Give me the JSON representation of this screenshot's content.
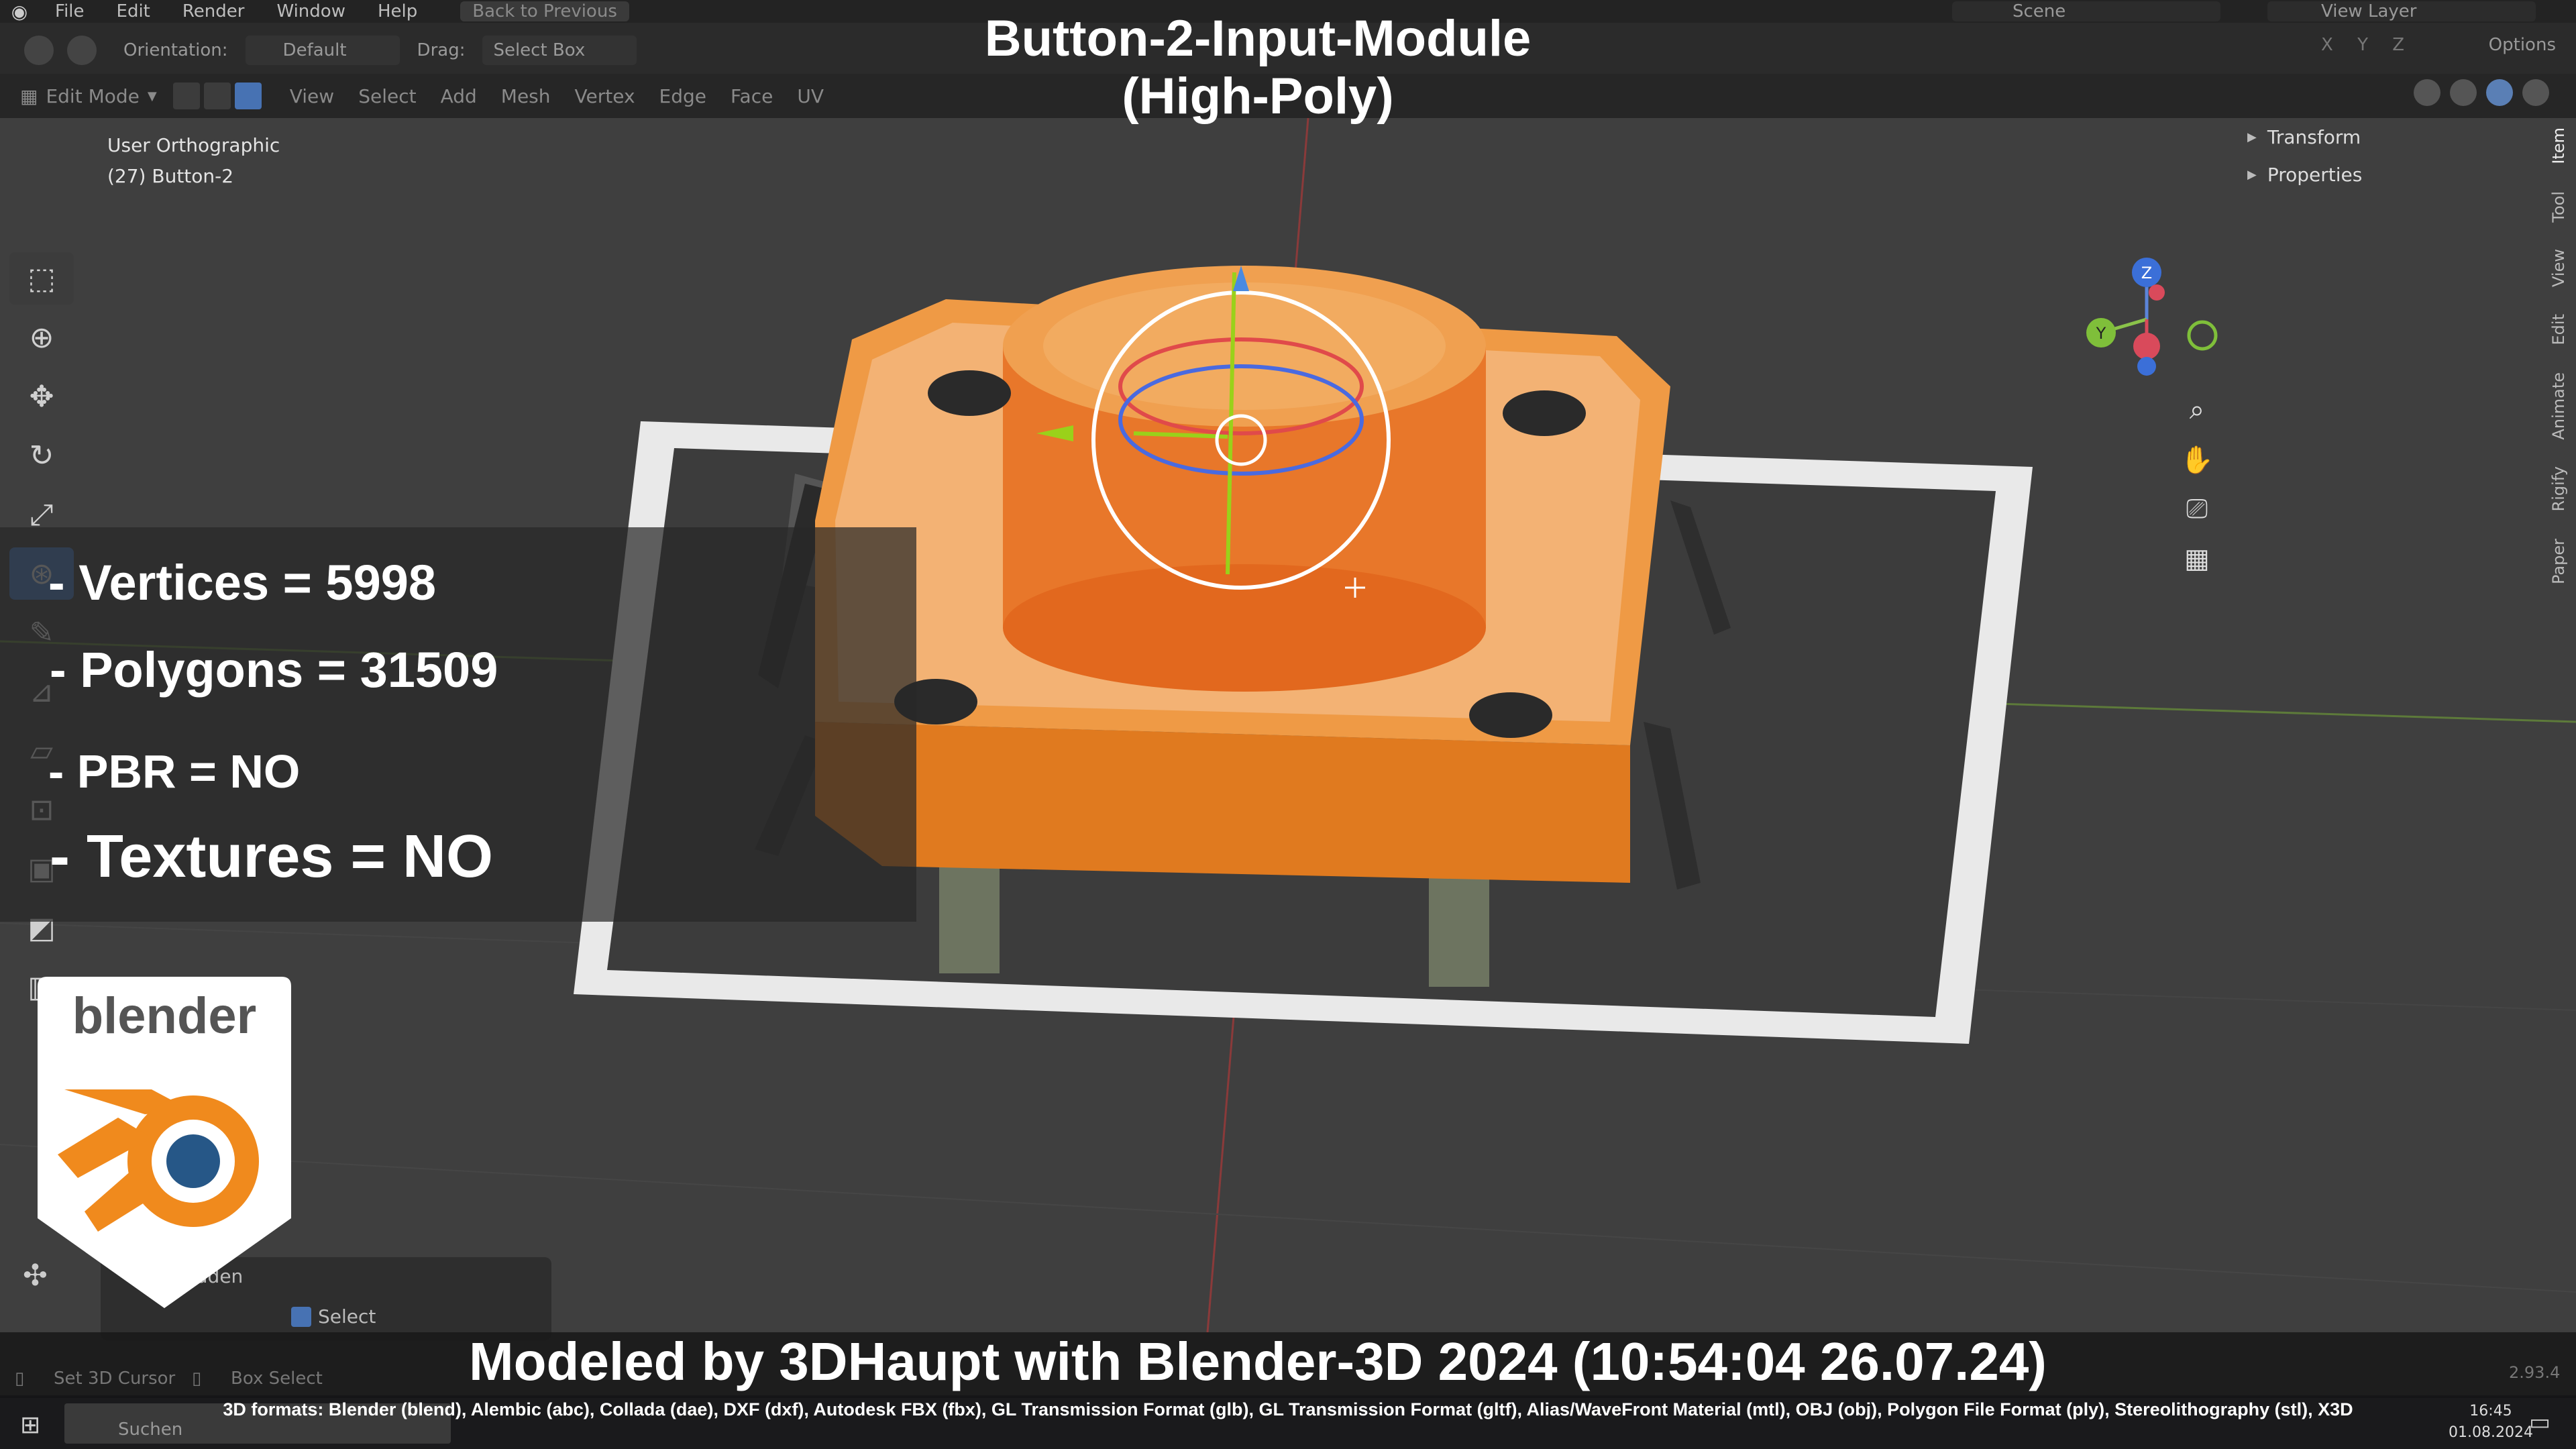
{
  "menu": {
    "items": [
      "File",
      "Edit",
      "Render",
      "Window",
      "Help"
    ],
    "back_label": "Back to Previous",
    "scene": "Scene",
    "view_layer": "View Layer"
  },
  "header": {
    "orientation_label": "Orientation:",
    "orientation_value": "Default",
    "drag_label": "Drag:",
    "drag_value": "Select Box",
    "options": "Options",
    "axes": "X Y Z"
  },
  "mode_row": {
    "mode": "Edit Mode",
    "items": [
      "View",
      "Select",
      "Add",
      "Mesh",
      "Vertex",
      "Edge",
      "Face",
      "UV"
    ]
  },
  "viewport": {
    "view_name": "User Orthographic",
    "object": "(27) Button-2"
  },
  "npanel": {
    "rows": [
      "Transform",
      "Properties"
    ],
    "tabs": [
      "Item",
      "Tool",
      "View",
      "Edit",
      "Animate",
      "Rigify",
      "Paper"
    ]
  },
  "gizmo_axes": {
    "z": "Z",
    "y": "Y"
  },
  "title": {
    "line1": "Button-2-Input-Module",
    "line2": "(High-Poly)"
  },
  "stats": {
    "vertices": "- Vertices = 5998",
    "polygons": "- Polygons = 31509",
    "pbr": "- PBR =  NO",
    "textures": "- Textures = NO"
  },
  "badge": {
    "wordmark": "blender"
  },
  "last_operator": {
    "line1": "idden",
    "line2": "Select"
  },
  "caption": "Modeled by 3DHaupt with Blender-3D 2024 (10:54:04  26.07.24)",
  "formats": "3D formats: Blender (blend), Alembic (abc), Collada (dae), DXF (dxf), Autodesk FBX (fbx), GL Transmission Format (glb), GL Transmission Format (gltf), Alias/WaveFront Material (mtl), OBJ (obj), Polygon File Format (ply), Stereolithography (stl), X3D",
  "statusbar": {
    "left": "Set 3D Cursor",
    "middle": "Box Select",
    "version": "2.93.4"
  },
  "taskbar": {
    "search": "Suchen",
    "time": "16:45",
    "date": "01.08.2024"
  },
  "colors": {
    "accent": "#4772b3",
    "mesh_orange": "#e8872a",
    "highlight": "#ffffff"
  }
}
